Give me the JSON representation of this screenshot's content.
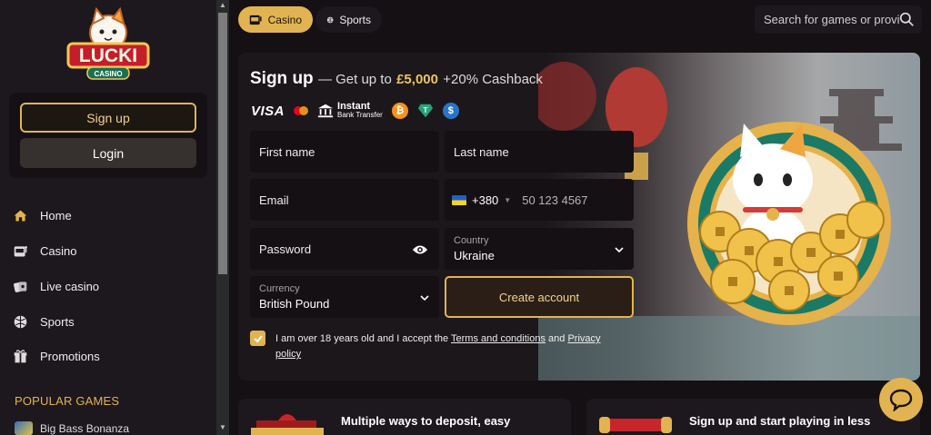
{
  "brand": {
    "name": "LUCKI",
    "sub": "CASINO"
  },
  "sidebar": {
    "signup_label": "Sign up",
    "login_label": "Login",
    "items": [
      {
        "label": "Home",
        "icon": "home-icon"
      },
      {
        "label": "Casino",
        "icon": "slot-machine-icon"
      },
      {
        "label": "Live casino",
        "icon": "cards-icon"
      },
      {
        "label": "Sports",
        "icon": "ball-icon"
      },
      {
        "label": "Promotions",
        "icon": "gift-icon"
      }
    ],
    "popular_heading": "POPULAR GAMES",
    "first_game": "Big Bass Bonanza"
  },
  "topbar": {
    "tabs": [
      {
        "label": "Casino",
        "active": true
      },
      {
        "label": "Sports",
        "active": false
      }
    ],
    "search_placeholder": "Search for games or provi"
  },
  "hero": {
    "title": "Sign up",
    "subtitle_prefix": "— Get up to",
    "amount": "£5,000",
    "subtitle_suffix": "+20% Cashback",
    "payments": {
      "visa": "VISA",
      "instant_line1": "Instant",
      "instant_line2": "Bank Transfer",
      "crypto": [
        "bitcoin-icon",
        "tether-icon",
        "usdc-icon"
      ]
    }
  },
  "form": {
    "first_name_placeholder": "First name",
    "last_name_placeholder": "Last name",
    "email_placeholder": "Email",
    "phone_code": "+380",
    "phone_placeholder": "50 123 4567",
    "password_placeholder": "Password",
    "country_label": "Country",
    "country_value": "Ukraine",
    "currency_label": "Currency",
    "currency_value": "British Pound",
    "create_label": "Create account",
    "terms_checked": true,
    "terms_prefix": "I am over 18 years old and I accept the",
    "terms_link": "Terms and conditions",
    "terms_and": "and",
    "privacy_link": "Privacy policy"
  },
  "cards": [
    {
      "title": "Multiple ways to deposit, easy"
    },
    {
      "title": "Sign up and start playing in less"
    }
  ],
  "colors": {
    "accent": "#e2b451",
    "background": "#141014",
    "panel": "#1d181d"
  }
}
